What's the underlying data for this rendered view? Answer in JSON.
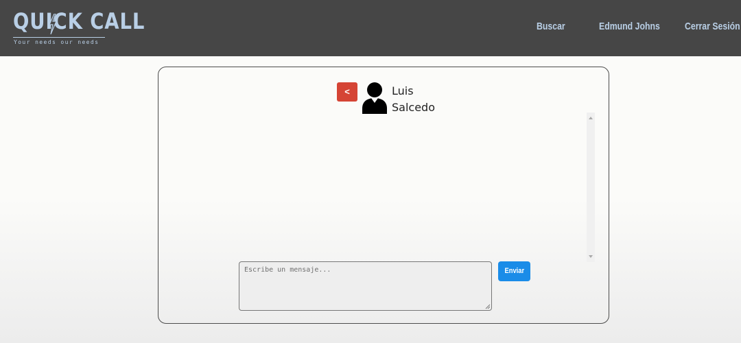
{
  "colors": {
    "header_bg": "#464646",
    "accent_text": "#b9cfe6",
    "back_button": "#d54435",
    "send_button": "#1a8ce8"
  },
  "header": {
    "logo_text": "QUICK CALL",
    "logo_tagline": "Your needs our needs",
    "nav": {
      "search_label": "Buscar",
      "user_label": "Edmund Johns",
      "logout_label": "Cerrar Sesión"
    }
  },
  "chat": {
    "back_label": "<",
    "avatar_icon": "user-silhouette-icon",
    "contact_first_name": "Luis",
    "contact_last_name": "Salcedo",
    "messages": [],
    "composer": {
      "placeholder": "Escribe un mensaje...",
      "value": ""
    },
    "send_label": "Enviar"
  }
}
